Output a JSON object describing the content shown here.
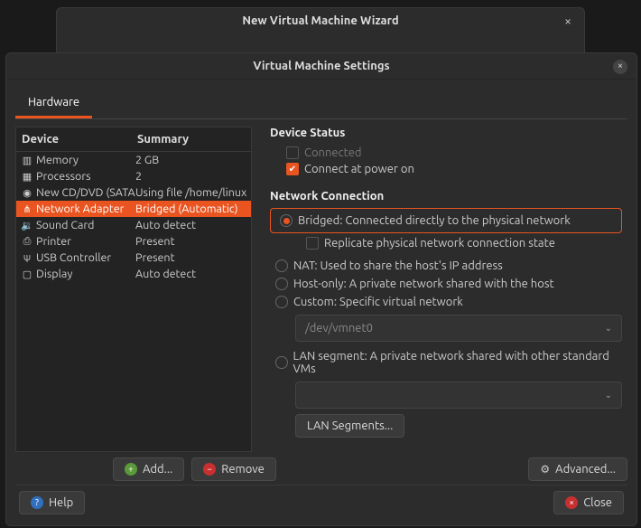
{
  "wizard": {
    "title": "New Virtual Machine Wizard"
  },
  "settings": {
    "title": "Virtual Machine Settings"
  },
  "tabs": {
    "hardware": "Hardware"
  },
  "device_headers": {
    "device": "Device",
    "summary": "Summary"
  },
  "devices": [
    {
      "name": "Memory",
      "summary": "2 GB"
    },
    {
      "name": "Processors",
      "summary": "2"
    },
    {
      "name": "New CD/DVD (SATA)",
      "summary": "Using file /home/linuxte"
    },
    {
      "name": "Network Adapter",
      "summary": "Bridged (Automatic)"
    },
    {
      "name": "Sound Card",
      "summary": "Auto detect"
    },
    {
      "name": "Printer",
      "summary": "Present"
    },
    {
      "name": "USB Controller",
      "summary": "Present"
    },
    {
      "name": "Display",
      "summary": "Auto detect"
    }
  ],
  "status": {
    "title": "Device Status",
    "connected": "Connected",
    "power_on": "Connect at power on"
  },
  "network": {
    "title": "Network Connection",
    "bridged": "Bridged: Connected directly to the physical network",
    "replicate": "Replicate physical network connection state",
    "nat": "NAT: Used to share the host's IP address",
    "hostonly": "Host-only: A private network shared with the host",
    "custom": "Custom: Specific virtual network",
    "custom_value": "/dev/vmnet0",
    "lanseg": "LAN segment: A private network shared with other standard VMs",
    "lanseg_btn": "LAN Segments...",
    "advanced_btn": "Advanced..."
  },
  "buttons": {
    "add": "Add...",
    "remove": "Remove",
    "help": "Help",
    "close": "Close"
  }
}
